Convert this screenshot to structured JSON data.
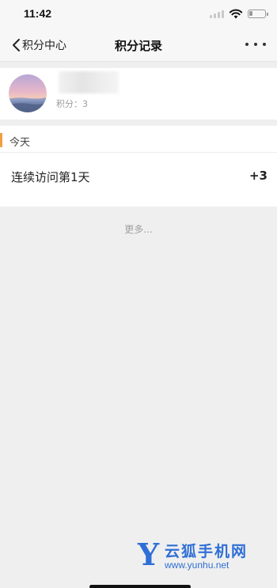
{
  "status_bar": {
    "time": "11:42",
    "battery_level": 0.2,
    "icons": [
      "signal-icon",
      "wifi-icon",
      "battery-icon"
    ]
  },
  "nav": {
    "back_label": "积分中心",
    "title": "积分记录",
    "more_icon": "more-icon"
  },
  "profile": {
    "avatar": "avatar-image",
    "points_label": "积分：",
    "points_value": "3"
  },
  "records": {
    "section_title": "今天",
    "accent_color": "#f0a040",
    "items": [
      {
        "label": "连续访问第1天",
        "points": "+3"
      }
    ]
  },
  "more_link": "更多...",
  "watermark": {
    "letter": "Y",
    "name": "云狐手机网",
    "url": "www.yunhu.net",
    "color": "#2f6fd6"
  }
}
